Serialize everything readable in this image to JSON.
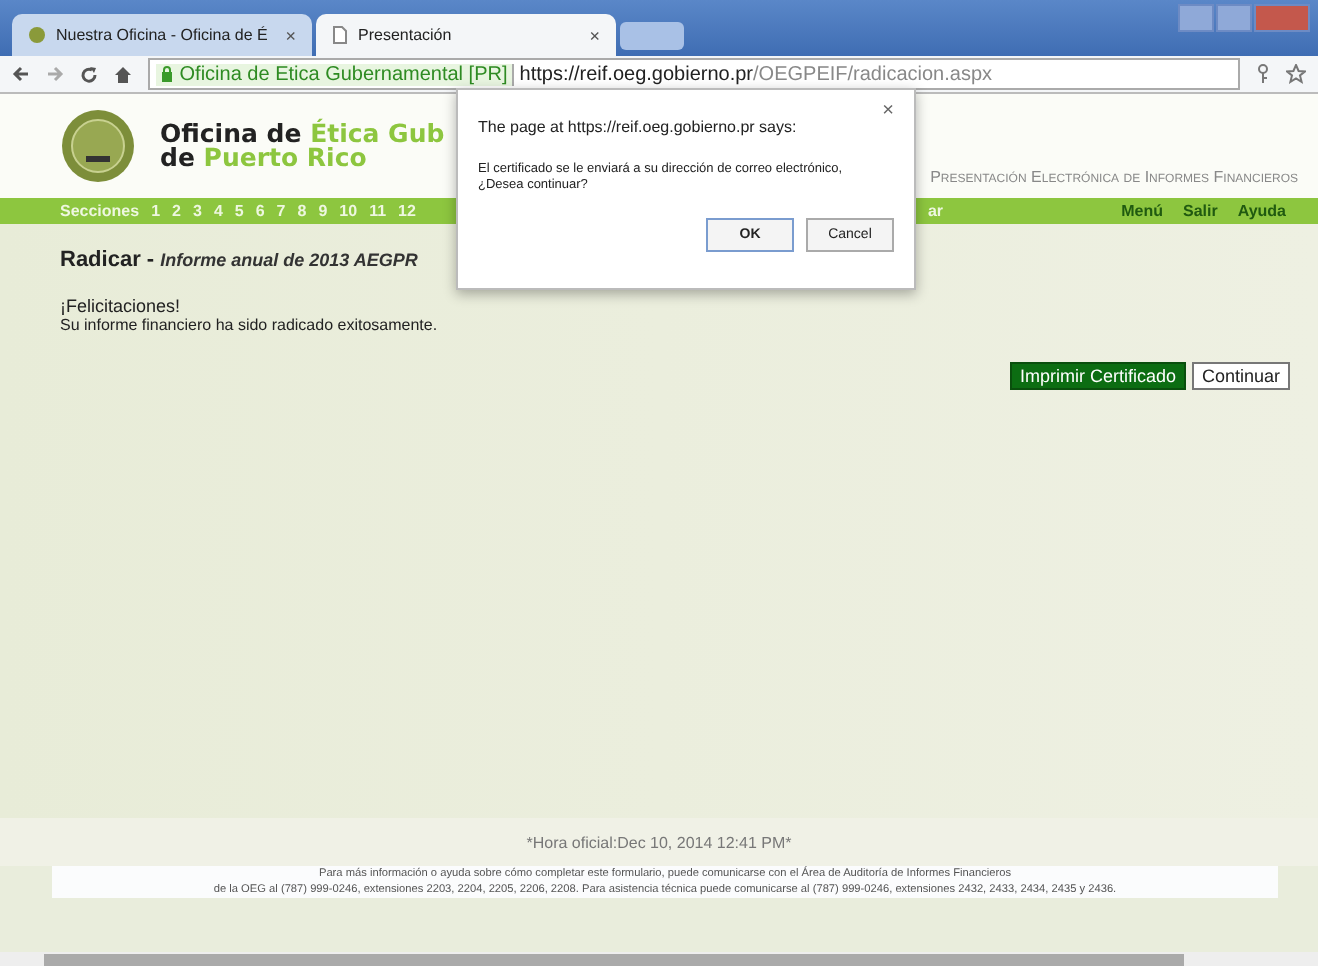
{
  "browser": {
    "tabs": [
      {
        "label": "Nuestra Oficina - Oficina de É",
        "close": "×",
        "selected": false
      },
      {
        "label": "Presentación",
        "close": "×",
        "selected": true
      }
    ],
    "site_identity": "Oficina de Etica Gubernamental [PR]",
    "url_host": "https://reif.oeg.gobierno.pr",
    "url_path": "/OEGPEIF/radicacion.aspx"
  },
  "header": {
    "title_lines": [
      {
        "text": "Oficina de",
        "highlight_text": "Ética Gub"
      },
      {
        "text": "de",
        "highlight_text": "Puerto Rico"
      }
    ],
    "subtitle": "Presentación Electrónica de Informes Financieros"
  },
  "nav": {
    "label": "Secciones",
    "sections": [
      "1",
      "2",
      "3",
      "4",
      "5",
      "6",
      "7",
      "8",
      "9",
      "10",
      "11",
      "12"
    ],
    "partial_item": "ar",
    "menu": [
      "Menú",
      "Salir",
      "Ayuda"
    ]
  },
  "heading": {
    "title": "Radicar",
    "separator": "-",
    "subtitle": "Informe anual de 2013 AEGPR"
  },
  "message": {
    "title": "¡Felicitaciones!",
    "body": "Su informe financiero ha sido radicado exitosamente."
  },
  "buttons": [
    {
      "label": "Imprimir Certificado",
      "kind": "primary"
    },
    {
      "label": "Continuar",
      "kind": "secondary"
    }
  ],
  "official_time": "*Hora oficial:Dec 10, 2014 12:41 PM*",
  "footer": [
    "Para más información o ayuda sobre cómo completar este formulario, puede comunicarse con el Área de Auditoría de Informes Financieros",
    "de la OEG al (787) 999-0246, extensiones 2203, 2204, 2205, 2206, 2208. Para asistencia técnica puede comunicarse al (787) 999-0246, extensiones 2432, 2433, 2434, 2435 y 2436."
  ],
  "dialog": {
    "title": "The page at https://reif.oeg.gobierno.pr says:",
    "close": "×",
    "message": [
      "El certificado se le enviará a su dirección de correo electrónico,",
      "¿Desea continuar?"
    ],
    "buttons": [
      "OK",
      "Cancel"
    ]
  }
}
